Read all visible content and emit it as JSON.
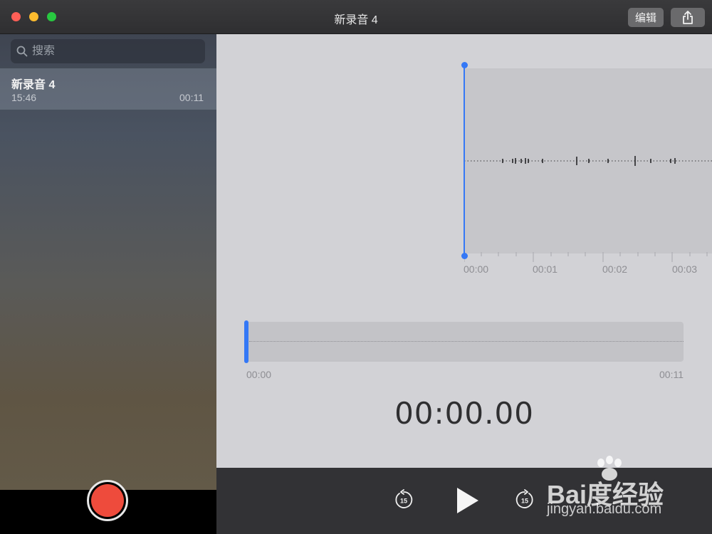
{
  "window": {
    "title": "新录音 4",
    "edit_label": "编辑",
    "share_icon": "share-icon"
  },
  "sidebar": {
    "search_placeholder": "搜索",
    "recordings": [
      {
        "title": "新录音 4",
        "time": "15:46",
        "duration": "00:11"
      }
    ],
    "record_button": "record-button"
  },
  "waveform": {
    "tick_labels": [
      "00:00",
      "00:01",
      "00:02",
      "00:03"
    ],
    "playhead_color": "#3478f6"
  },
  "overview": {
    "start": "00:00",
    "end": "00:11",
    "position_fraction": 0
  },
  "player": {
    "current_time": "00:00.00",
    "skip_back_label": "15",
    "skip_forward_label": "15"
  },
  "watermark": {
    "text": "Bai度经验",
    "url": "jingyan.baidu.com"
  },
  "colors": {
    "accent": "#3478f6",
    "record": "#ee4b3c"
  }
}
